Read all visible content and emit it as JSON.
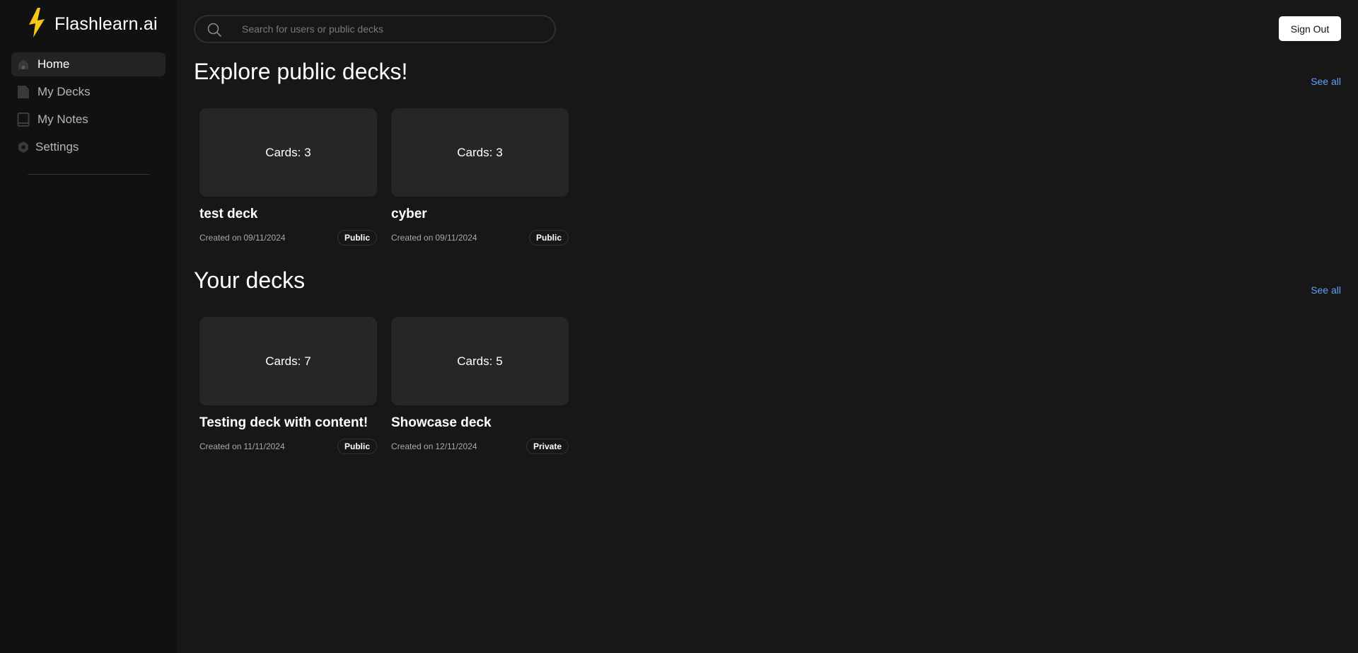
{
  "brand": {
    "name": "Flashlearn.ai",
    "logo_icon": "lightning-bolt-icon",
    "accent": "#f5c518"
  },
  "sidebar": {
    "items": [
      {
        "label": "Home",
        "icon": "home-icon",
        "active": true
      },
      {
        "label": "My Decks",
        "icon": "deck-icon",
        "active": false
      },
      {
        "label": "My Notes",
        "icon": "notebook-icon",
        "active": false
      },
      {
        "label": "Settings",
        "icon": "gear-icon",
        "active": false
      }
    ]
  },
  "search": {
    "placeholder": "Search for users or public decks",
    "value": ""
  },
  "header": {
    "sign_out_label": "Sign Out"
  },
  "sections": {
    "public": {
      "title": "Explore public decks!",
      "see_all": "See all",
      "decks": [
        {
          "cards_label": "Cards:",
          "card_count": "3",
          "name": "test deck",
          "created_label": "Created on",
          "created_date": "09/11/2024",
          "visibility": "Public"
        },
        {
          "cards_label": "Cards:",
          "card_count": "3",
          "name": "cyber",
          "created_label": "Created on",
          "created_date": "09/11/2024",
          "visibility": "Public"
        }
      ]
    },
    "yours": {
      "title": "Your decks",
      "see_all": "See all",
      "decks": [
        {
          "cards_label": "Cards:",
          "card_count": "7",
          "name": "Testing deck with content!",
          "created_label": "Created on",
          "created_date": "11/11/2024",
          "visibility": "Public"
        },
        {
          "cards_label": "Cards:",
          "card_count": "5",
          "name": "Showcase deck",
          "created_label": "Created on",
          "created_date": "12/11/2024",
          "visibility": "Private"
        }
      ]
    }
  },
  "colors": {
    "background": "#171717",
    "sidebar": "#111111",
    "card": "#262626",
    "link": "#5ea3ff"
  }
}
